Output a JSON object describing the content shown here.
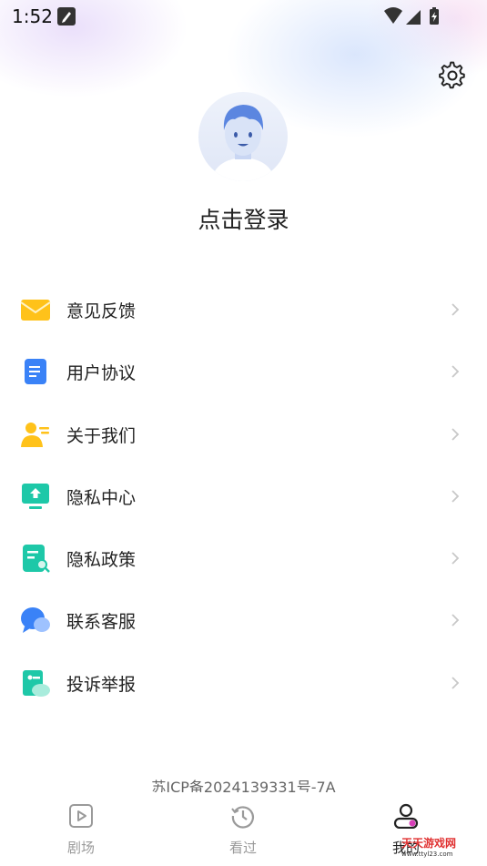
{
  "status_bar": {
    "time": "1:52"
  },
  "header": {
    "login_text": "点击登录"
  },
  "menu": {
    "items": [
      {
        "label": "意见反馈",
        "icon": "envelope-icon"
      },
      {
        "label": "用户协议",
        "icon": "document-icon"
      },
      {
        "label": "关于我们",
        "icon": "user-info-icon"
      },
      {
        "label": "隐私中心",
        "icon": "upload-monitor-icon"
      },
      {
        "label": "隐私政策",
        "icon": "policy-search-icon"
      },
      {
        "label": "联系客服",
        "icon": "chat-bubble-icon"
      },
      {
        "label": "投诉举报",
        "icon": "report-icon"
      }
    ]
  },
  "footer": {
    "icp": "苏ICP备2024139331号-7A"
  },
  "tabbar": {
    "tabs": [
      {
        "label": "剧场",
        "icon": "play-square-icon"
      },
      {
        "label": "看过",
        "icon": "history-clock-icon"
      },
      {
        "label": "我的",
        "icon": "profile-icon",
        "active": true
      }
    ]
  },
  "watermark": {
    "text": "天天游戏网",
    "url": "www.ttyl23.com"
  },
  "colors": {
    "accent": "#1ec8a8",
    "yellow": "#ffc21a",
    "blue": "#3a82f7"
  }
}
